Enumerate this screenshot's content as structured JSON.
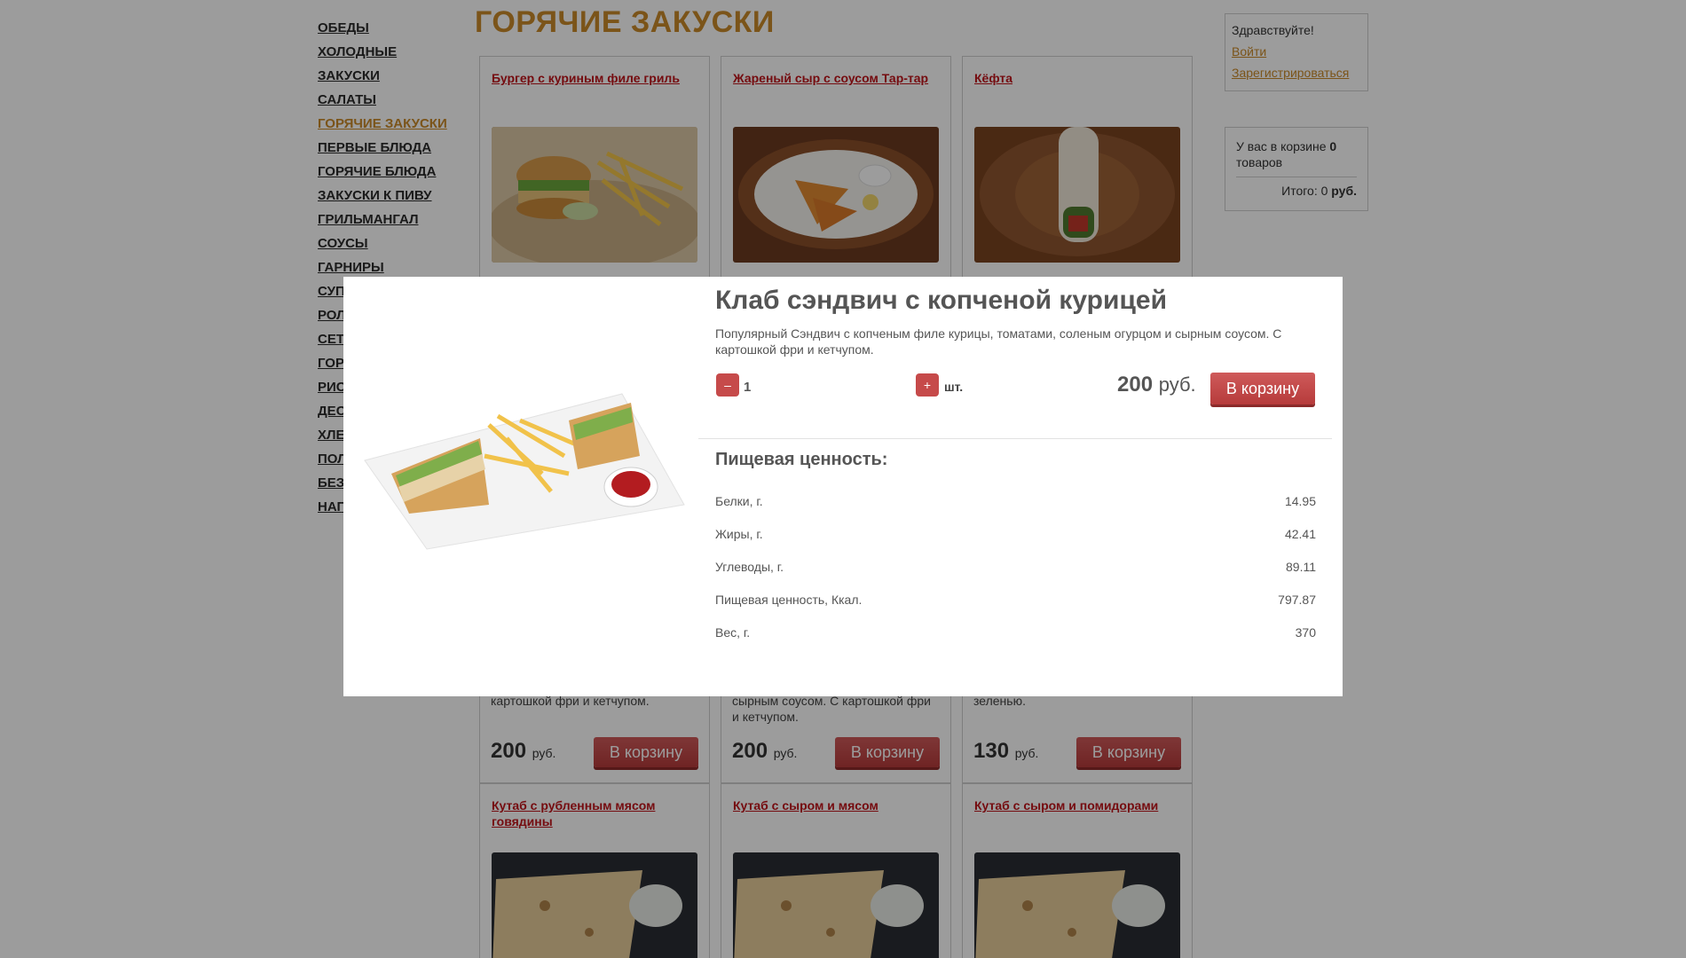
{
  "sidebar": {
    "items": [
      "ОБЕДЫ",
      "ХОЛОДНЫЕ",
      "ЗАКУСКИ",
      "САЛАТЫ",
      "ГОРЯЧИЕ ЗАКУСКИ",
      "ПЕРВЫЕ БЛЮДА",
      "ГОРЯЧИЕ БЛЮДА",
      "ЗАКУСКИ К ПИВУ",
      "ГРИЛЬМАНГАЛ",
      "СОУСЫ",
      "ГАРНИРЫ",
      "СУП",
      "РОЛ",
      "СЕТ",
      "ГОР",
      "РИС",
      "ДЕС",
      "ХЛЕ",
      "ПОЛ",
      "БЕЗ",
      "НАП"
    ],
    "active": "ГОРЯЧИЕ ЗАКУСКИ"
  },
  "page_title": "ГОРЯЧИЕ ЗАКУСКИ",
  "cards_row1": [
    {
      "name": "Бургер с куриным филе гриль"
    },
    {
      "name": "Жареный сыр с соусом Тар-тар"
    },
    {
      "name": "Кёфта"
    }
  ],
  "cards_row2": [
    {
      "desc": "картошкой фри и кетчупом.",
      "price": "200",
      "currency": "руб.",
      "button": "В корзину"
    },
    {
      "desc": "сырным соусом. С картошкой фри и кетчупом.",
      "price": "200",
      "currency": "руб.",
      "button": "В корзину"
    },
    {
      "desc": "зеленью.",
      "price": "130",
      "currency": "руб.",
      "button": "В корзину"
    }
  ],
  "cards_row3": [
    {
      "name": "Кутаб с рубленным мясом говядины"
    },
    {
      "name": "Кутаб с сыром и мясом"
    },
    {
      "name": "Кутаб с сыром и помидорами"
    }
  ],
  "user": {
    "greeting": "Здравствуйте!",
    "login": "Войти",
    "register": "Зарегистрироваться"
  },
  "cart": {
    "text_prefix": "У вас в корзине",
    "count": "0",
    "text_suffix": "товаров",
    "total_label": "Итого:",
    "total_value": "0",
    "total_currency": "руб."
  },
  "modal": {
    "title": "Клаб сэндвич с копченой курицей",
    "description": "Популярный Сэндвич с копченым филе курицы, томатами, соленым огурцом и сырным соусом. С картошкой фри и кетчупом.",
    "minus": "–",
    "plus": "+",
    "quantity": "1",
    "unit": "шт.",
    "price": "200",
    "currency": "руб.",
    "button": "В корзину",
    "nutrition_title": "Пищевая ценность:",
    "nutrition": [
      {
        "label": "Белки, г.",
        "value": "14.95"
      },
      {
        "label": "Жиры, г.",
        "value": "42.41"
      },
      {
        "label": "Углеводы, г.",
        "value": "89.11"
      },
      {
        "label": "Пищевая ценность, Ккал.",
        "value": "797.87"
      },
      {
        "label": "Вес, г.",
        "value": "370"
      }
    ]
  },
  "colors": {
    "accent": "#c98a2a",
    "link_red": "#c0151b",
    "button_red": "#c64a4a"
  }
}
